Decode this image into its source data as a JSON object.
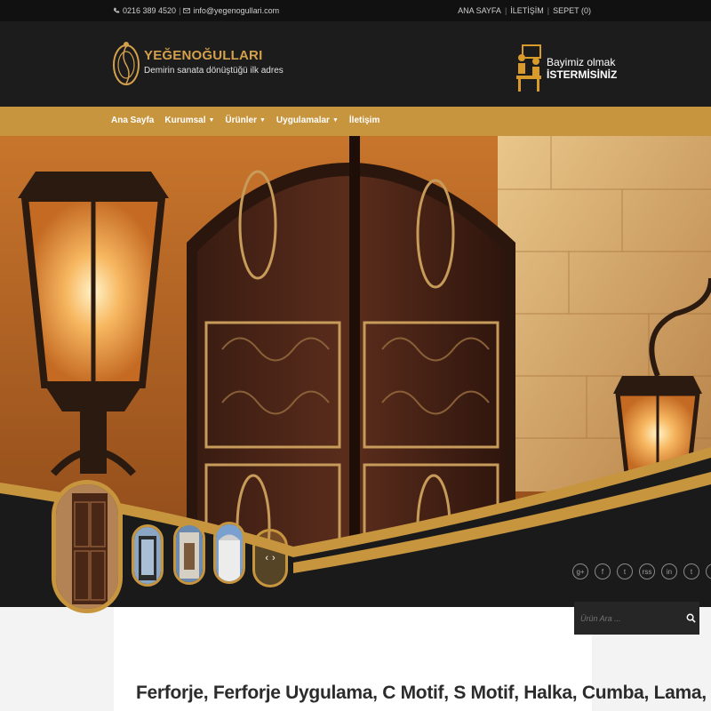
{
  "topbar": {
    "phone": "0216 389 4520",
    "email": "info@yegenogullari.com",
    "links": [
      "ANA SAYFA",
      "İLETİŞİM",
      "SEPET (0)"
    ]
  },
  "logo": {
    "brand": "YEĞENOĞULLARI",
    "tagline": "Demirin sanata dönüştüğü ilk adres"
  },
  "dealer": {
    "line1": "Bayimiz olmak",
    "line2": "İSTERMİSİNİZ"
  },
  "nav": {
    "items": [
      {
        "label": "Ana Sayfa"
      },
      {
        "label": "Kurumsal"
      },
      {
        "label": "Ürünler"
      },
      {
        "label": "Uygulamalar"
      },
      {
        "label": "İletişim"
      }
    ]
  },
  "slider": {
    "prev": "‹",
    "next": "›"
  },
  "socials": [
    "g+",
    "f",
    "t",
    "rss",
    "in",
    "t",
    "p",
    "✿"
  ],
  "search": {
    "placeholder": "Ürün Ara ..."
  },
  "content": {
    "title": "Ferforje, Ferforje Uygulama, C Motif, S Motif, Halka, Cumba, Lama,"
  },
  "colors": {
    "accent": "#c8953f",
    "dark": "#1c1c1c",
    "topbar": "#111111"
  }
}
